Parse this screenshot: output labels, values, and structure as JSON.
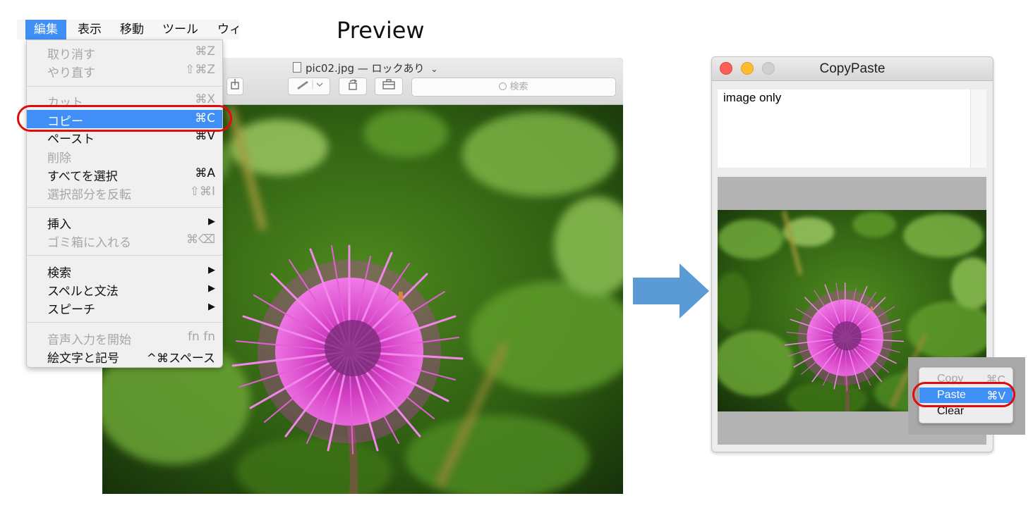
{
  "heading": "Preview",
  "preview": {
    "title": "pic02.jpg — ロックあり",
    "title_chevron": "⌄",
    "search_placeholder": "検索",
    "toolbar_icons": [
      "markup-pen-icon",
      "rotate-icon",
      "toolbox-icon"
    ]
  },
  "menubar": {
    "items": [
      "編集",
      "表示",
      "移動",
      "ツール",
      "ウィ"
    ]
  },
  "edit_menu": {
    "items": [
      {
        "label": "取り消す",
        "shortcut": "⌘Z",
        "enabled": false
      },
      {
        "label": "やり直す",
        "shortcut": "⇧⌘Z",
        "enabled": false
      },
      {
        "label": "カット",
        "shortcut": "⌘X",
        "enabled": false
      },
      {
        "label": "コピー",
        "shortcut": "⌘C",
        "enabled": true,
        "highlighted": true
      },
      {
        "label": "ペースト",
        "shortcut": "⌘V",
        "enabled": true
      },
      {
        "label": "削除",
        "shortcut": "",
        "enabled": false
      },
      {
        "label": "すべてを選択",
        "shortcut": "⌘A",
        "enabled": true
      },
      {
        "label": "選択部分を反転",
        "shortcut": "⇧⌘I",
        "enabled": false
      },
      {
        "label": "挿入",
        "shortcut": "▶",
        "enabled": true
      },
      {
        "label": "ゴミ箱に入れる",
        "shortcut": "⌘⌫",
        "enabled": false
      },
      {
        "label": "検索",
        "shortcut": "▶",
        "enabled": true
      },
      {
        "label": "スペルと文法",
        "shortcut": "▶",
        "enabled": true
      },
      {
        "label": "スピーチ",
        "shortcut": "▶",
        "enabled": true
      },
      {
        "label": "音声入力を開始",
        "shortcut": "fn fn",
        "enabled": false
      },
      {
        "label": "絵文字と記号",
        "shortcut": "^⌘スペース",
        "enabled": true
      }
    ]
  },
  "copypaste": {
    "title": "CopyPaste",
    "text_value": "image only",
    "traffic_lights": {
      "close": "#fe5f57",
      "minimize": "#febc2e",
      "zoom": "#d0d0d0"
    },
    "context_menu": [
      {
        "label": "Copy",
        "shortcut": "⌘C",
        "enabled": false
      },
      {
        "label": "Paste",
        "shortcut": "⌘V",
        "enabled": true,
        "highlighted": true
      },
      {
        "label": "Clear",
        "shortcut": "",
        "enabled": true
      }
    ]
  },
  "colors": {
    "accent": "#3f8ff6",
    "highlight_ring": "#e00b0b",
    "arrow": "#5b9bd5"
  }
}
